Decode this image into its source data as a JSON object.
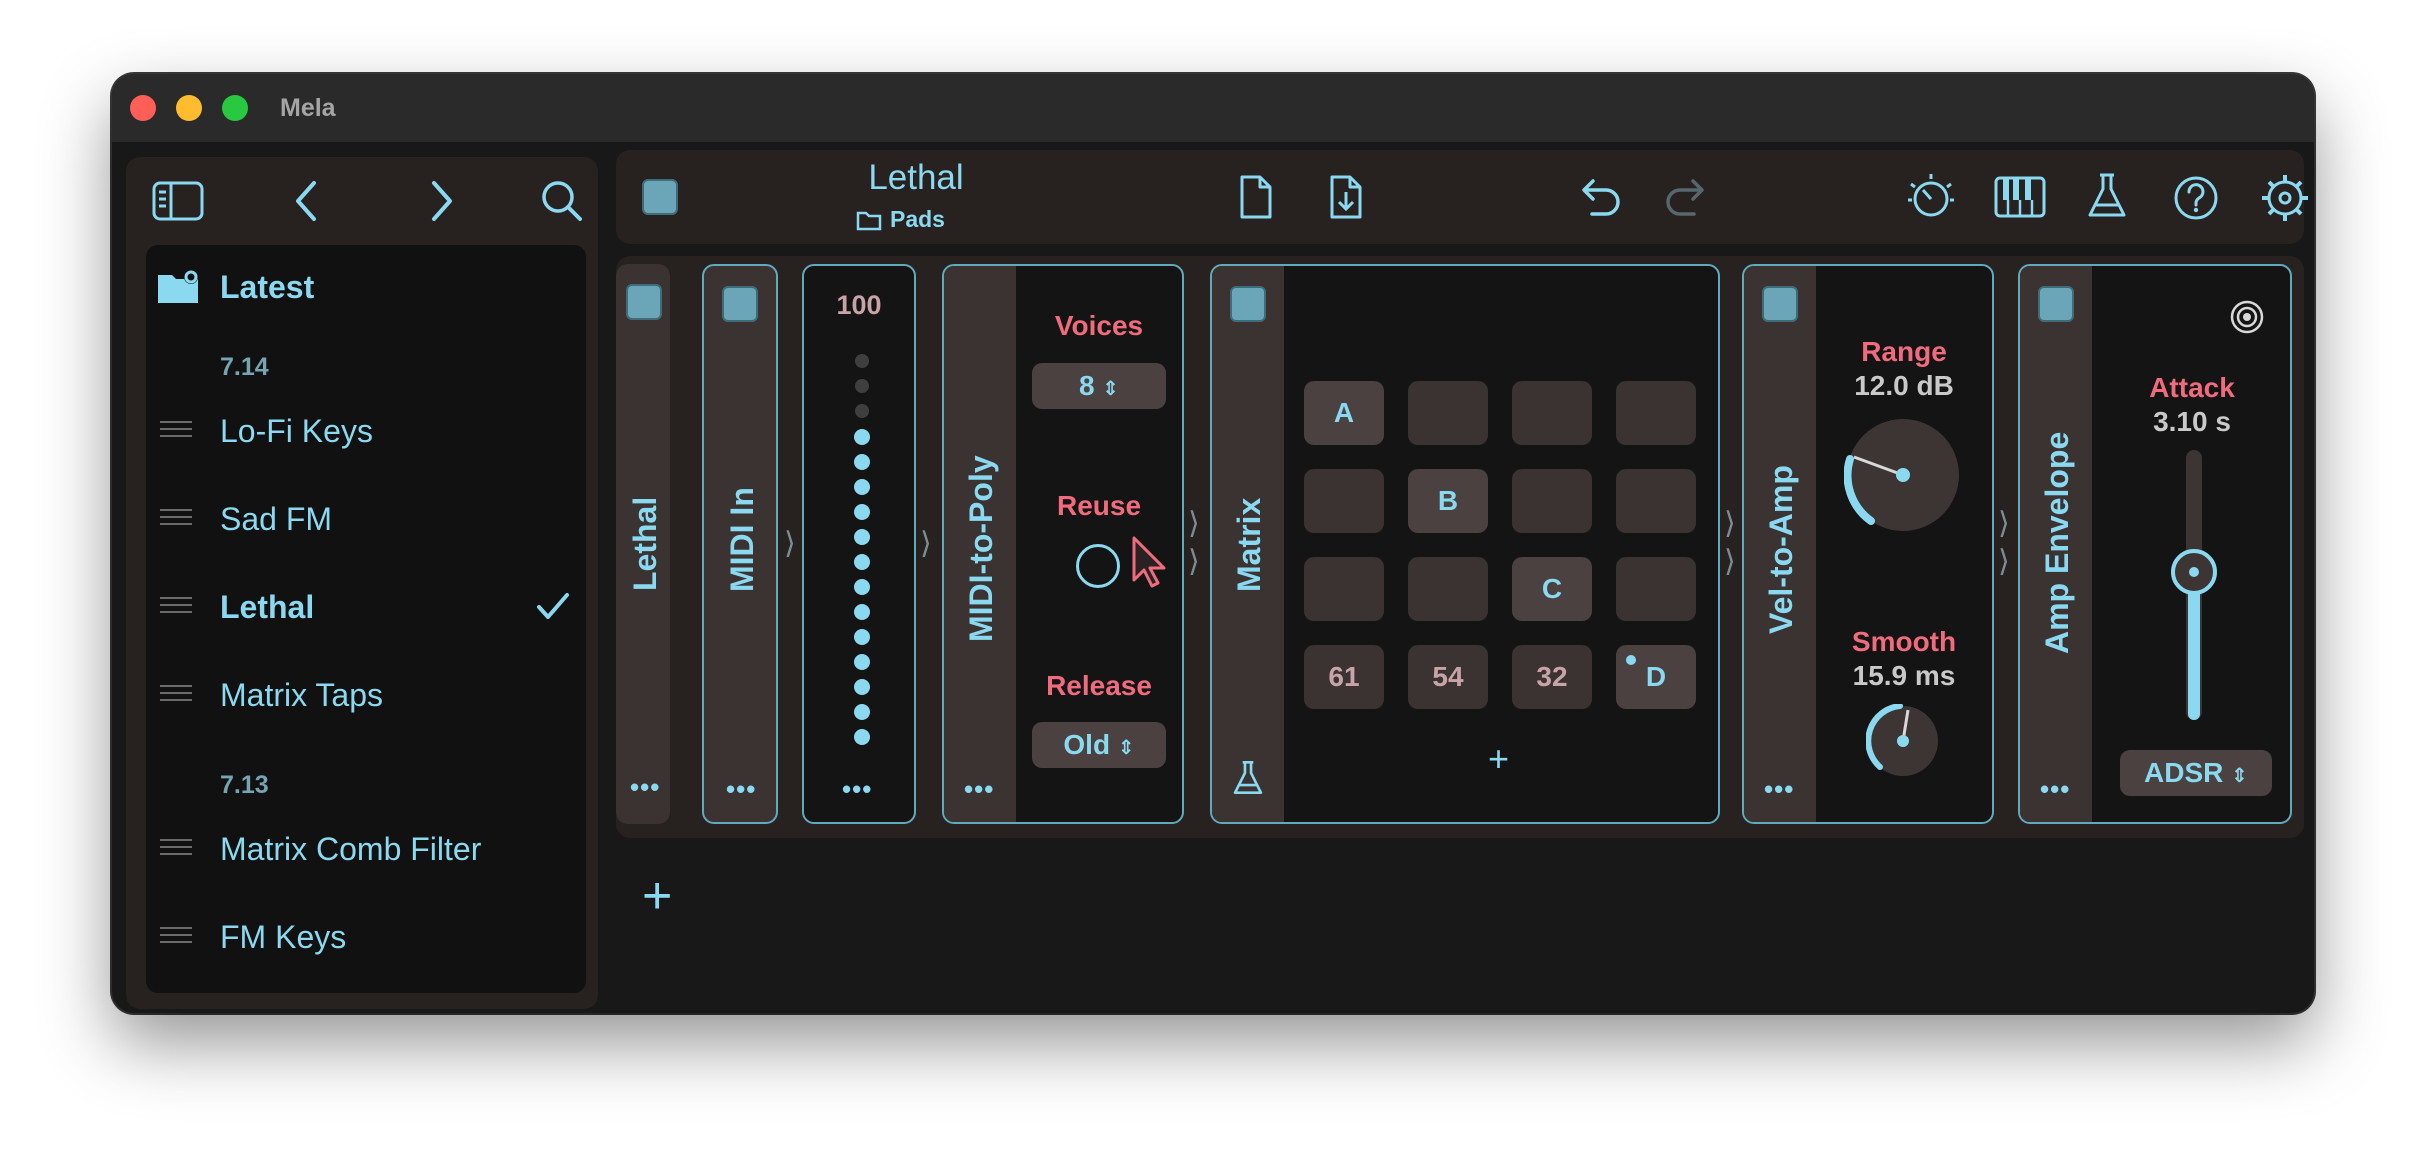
{
  "window": {
    "title": "Mela"
  },
  "sidebar": {
    "sections": [
      {
        "title": "Latest"
      }
    ],
    "items": [
      {
        "kind": "version",
        "label": "7.14"
      },
      {
        "kind": "preset",
        "label": "Lo-Fi Keys"
      },
      {
        "kind": "preset",
        "label": "Sad FM"
      },
      {
        "kind": "preset",
        "label": "Lethal",
        "selected": true
      },
      {
        "kind": "preset",
        "label": "Matrix Taps"
      },
      {
        "kind": "version",
        "label": "7.13"
      },
      {
        "kind": "preset",
        "label": "Matrix Comb Filter"
      },
      {
        "kind": "preset",
        "label": "FM Keys"
      }
    ]
  },
  "toolbar": {
    "preset_title": "Lethal",
    "preset_folder": "Pads"
  },
  "modules": {
    "lethal": {
      "label": "Lethal"
    },
    "midi_in": {
      "label": "MIDI In"
    },
    "meter": {
      "value": "100",
      "level": 0.85,
      "dots_total": 16,
      "dots_lit": 13
    },
    "midi_to_poly": {
      "label": "MIDI-to-Poly",
      "voices_label": "Voices",
      "voices_value": "8",
      "reuse_label": "Reuse",
      "release_label": "Release",
      "release_value": "Old"
    },
    "matrix": {
      "label": "Matrix",
      "rows": [
        [
          "A",
          "",
          "",
          ""
        ],
        [
          "",
          "B",
          "",
          ""
        ],
        [
          "",
          "",
          "C",
          ""
        ],
        [
          "61",
          "54",
          "32",
          "D"
        ]
      ]
    },
    "vel_to_amp": {
      "label": "Vel-to-Amp",
      "range_label": "Range",
      "range_value": "12.0 dB",
      "smooth_label": "Smooth",
      "smooth_value": "15.9 ms"
    },
    "amp_envelope": {
      "label": "Amp Envelope",
      "attack_label": "Attack",
      "attack_value": "3.10 s",
      "mode": "ADSR",
      "slider_level": 0.55
    }
  },
  "colors": {
    "accent": "#8ad9f0",
    "label_red": "#ef6b7d",
    "panel_border": "#62aabb",
    "background": "#181818"
  },
  "icons": [
    "sidebar-toggle-icon",
    "chevron-left-icon",
    "chevron-right-icon",
    "search-icon",
    "folder-gear-icon",
    "checkmark-icon",
    "folder-icon",
    "new-document-icon",
    "import-document-icon",
    "undo-icon",
    "redo-icon",
    "tuning-icon",
    "piano-keys-icon",
    "flask-icon",
    "help-icon",
    "settings-gear-icon",
    "info-icon",
    "target-icon",
    "plus-icon"
  ]
}
